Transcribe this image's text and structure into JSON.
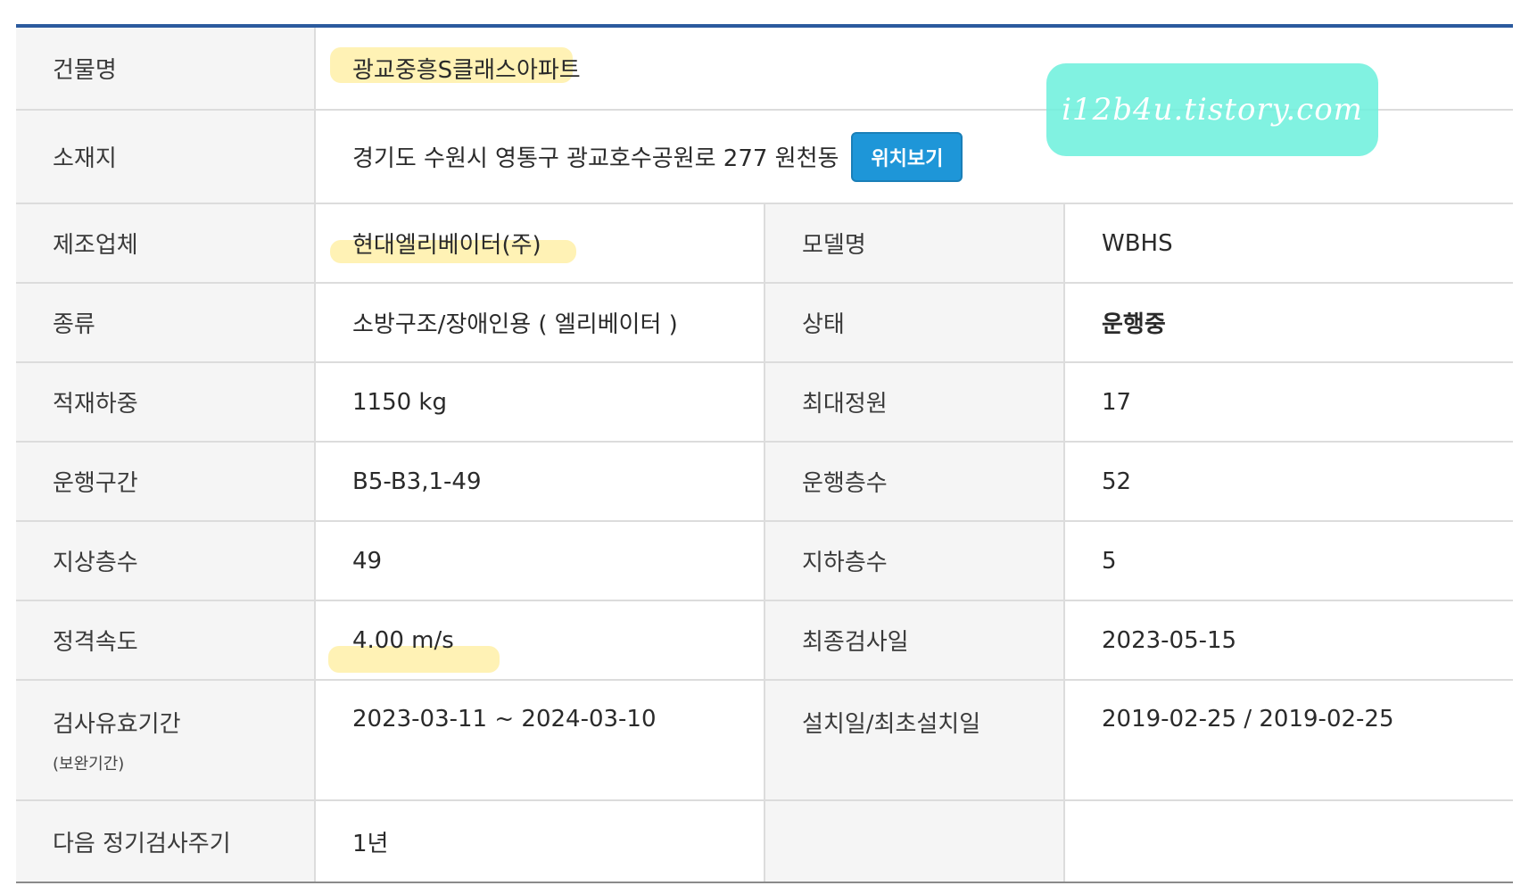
{
  "fields": {
    "building_name": {
      "label": "건물명",
      "value": "광교중흥S클래스아파트"
    },
    "address": {
      "label": "소재지",
      "value": "경기도 수원시 영통구 광교호수공원로 277 원천동",
      "button": "위치보기"
    },
    "manufacturer": {
      "label": "제조업체",
      "value": "현대엘리베이터(주)"
    },
    "model": {
      "label": "모델명",
      "value": "WBHS"
    },
    "type": {
      "label": "종류",
      "value": "소방구조/장애인용 ( 엘리베이터 )"
    },
    "status": {
      "label": "상태",
      "value": "운행중"
    },
    "load": {
      "label": "적재하중",
      "value": "1150 kg"
    },
    "capacity": {
      "label": "최대정원",
      "value": "17"
    },
    "section": {
      "label": "운행구간",
      "value": "B5-B3,1-49"
    },
    "floors": {
      "label": "운행층수",
      "value": "52"
    },
    "above": {
      "label": "지상층수",
      "value": "49"
    },
    "below": {
      "label": "지하층수",
      "value": "5"
    },
    "speed": {
      "label": "정격속도",
      "value": "4.00 m/s"
    },
    "last_inspection": {
      "label": "최종검사일",
      "value": "2023-05-15"
    },
    "validity": {
      "label": "검사유효기간",
      "sublabel": "(보완기간)",
      "value": "2023-03-11 ~ 2024-03-10"
    },
    "install": {
      "label": "설치일/최초설치일",
      "value": "2019-02-25 / 2019-02-25"
    },
    "next_cycle": {
      "label": "다음 정기검사주기",
      "value": "1년"
    }
  },
  "watermark": "i12b4u.tistory.com",
  "colors": {
    "header_bar": "#2b5a9e",
    "button": "#1e96d8",
    "highlight": "#ffe878",
    "watermark_bg": "#6bf0dc"
  }
}
